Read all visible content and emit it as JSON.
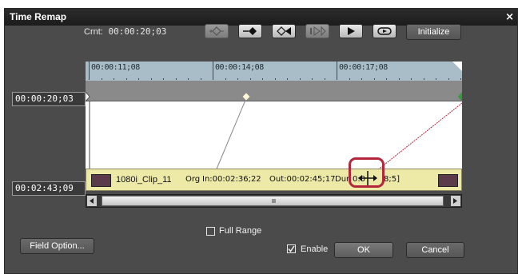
{
  "dialog": {
    "title": "Time Remap",
    "close_glyph": "×"
  },
  "toolbar": {
    "current_label": "Crnt:",
    "current_timecode": "00:00:20;03",
    "buttons": [
      {
        "icon": "add-keyframe-icon",
        "enabled": false
      },
      {
        "icon": "delete-keyframe-icon",
        "enabled": true
      },
      {
        "icon": "previous-keyframe-icon",
        "enabled": true
      },
      {
        "icon": "next-keyframe-icon",
        "enabled": false
      },
      {
        "icon": "play-icon",
        "enabled": true
      },
      {
        "icon": "loop-icon",
        "enabled": true
      }
    ],
    "initialize_label": "Initialize"
  },
  "timeline": {
    "ruler_labels": [
      "00:00:11;08",
      "00:00:14;08",
      "00:00:17;08"
    ],
    "playhead_timecode": "00:00:20;03",
    "source_timecode": "00:02:43;09"
  },
  "clip": {
    "name": "1080i_Clip_11",
    "org_label": "Org",
    "in_label": "In:00:02:36;22",
    "out_label": "Out:00:02:45;17",
    "dur_label": "Dur:",
    "dur_value": "0:0",
    "dur_tail": "8;5]"
  },
  "options": {
    "full_range_label": "Full Range",
    "full_range_checked": false,
    "enable_label": "Enable",
    "enable_checked": true
  },
  "buttons": {
    "field_option": "Field Option...",
    "ok": "OK",
    "cancel": "Cancel"
  },
  "colors": {
    "accent_highlight": "#b3263b",
    "keyframe_end": "#2e9d3a",
    "clip_bar": "#ede9a7",
    "ruler": "#a9bdc8"
  }
}
